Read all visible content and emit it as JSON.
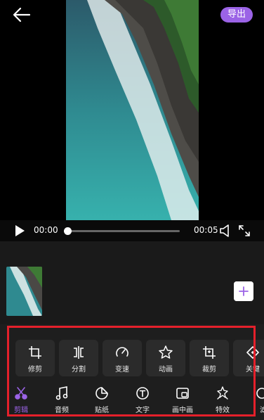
{
  "header": {
    "export_label": "导出"
  },
  "player": {
    "current_time": "00:00",
    "duration": "00:05",
    "progress": 0
  },
  "tools": [
    {
      "label": "修剪",
      "icon": "crop-icon"
    },
    {
      "label": "分割",
      "icon": "split-icon"
    },
    {
      "label": "变速",
      "icon": "speed-icon"
    },
    {
      "label": "动画",
      "icon": "star-icon"
    },
    {
      "label": "裁剪",
      "icon": "crop-icon"
    },
    {
      "label": "关键",
      "icon": "keyframe-icon"
    }
  ],
  "nav": [
    {
      "label": "剪辑",
      "icon": "scissors-icon",
      "active": true
    },
    {
      "label": "音频",
      "icon": "music-note-icon"
    },
    {
      "label": "贴纸",
      "icon": "sticker-icon"
    },
    {
      "label": "文字",
      "icon": "text-icon"
    },
    {
      "label": "画中画",
      "icon": "picture-in-picture-icon"
    },
    {
      "label": "特效",
      "icon": "effects-icon"
    },
    {
      "label": "滤",
      "icon": "filter-icon"
    }
  ],
  "colors": {
    "accent": "#9b63e6",
    "highlight": "#e5202b"
  }
}
